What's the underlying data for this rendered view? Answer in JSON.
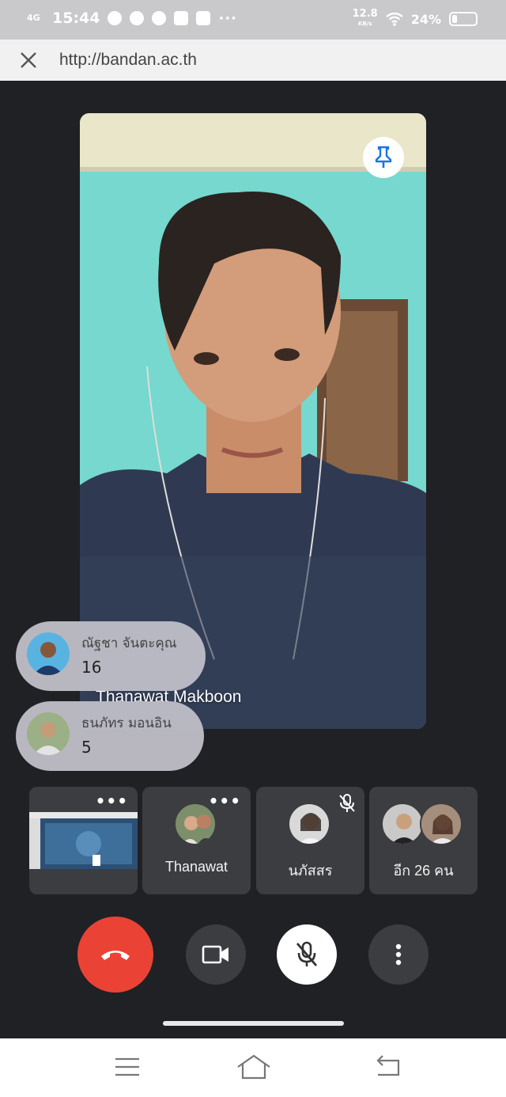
{
  "status_bar": {
    "network": "4G",
    "time": "15:44",
    "more": "···",
    "speed_value": "12.8",
    "speed_unit": "KB/s",
    "battery": "24%"
  },
  "browser": {
    "url": "http://bandan.ac.th",
    "close_icon": "close-icon"
  },
  "main_video": {
    "participant_name": "Thanawat Makboon",
    "pin_icon": "pin-icon"
  },
  "reactions": [
    {
      "name": "ณัฐชา จันตะคุณ",
      "count": "16"
    },
    {
      "name": "ธนภัทร มอนอิน",
      "count": "5"
    }
  ],
  "tiles": {
    "screen_share": {
      "more": "•••"
    },
    "thanawat": {
      "label": "Thanawat",
      "more": "•••"
    },
    "napatsorn": {
      "label": "นภัสสร",
      "muted_icon": "mic-off-icon"
    },
    "others": {
      "label": "อีก 26 คน"
    }
  },
  "controls": {
    "end_call_icon": "phone-hangup-icon",
    "camera_icon": "video-camera-icon",
    "mic_icon": "mic-off-icon",
    "more_icon": "more-vert-icon"
  },
  "colors": {
    "end_call": "#ea4335",
    "background": "#202124",
    "tile": "#3c3d40"
  }
}
